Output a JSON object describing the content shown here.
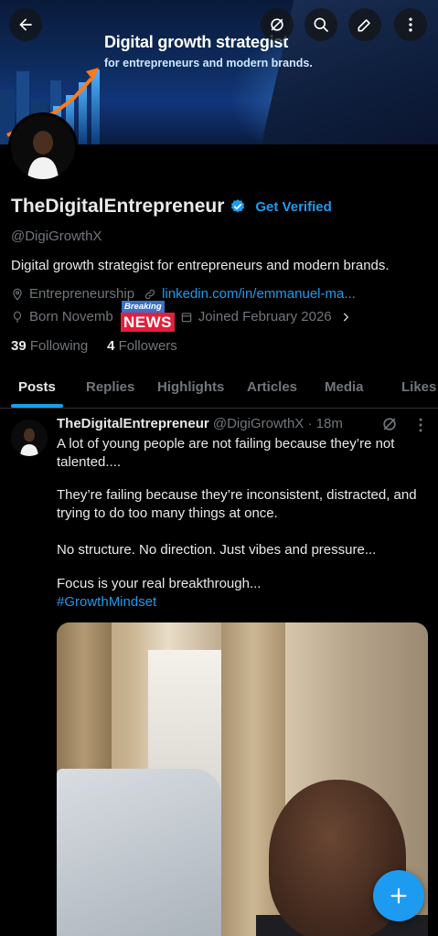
{
  "banner": {
    "headline": "Digital growth strategist",
    "subline": "for entrepreneurs and modern brands."
  },
  "top_actions": {
    "back_icon": "arrow-left-icon",
    "grok_icon": "grok-icon",
    "search_icon": "search-icon",
    "edit_icon": "edit-icon",
    "more_icon": "more-vertical-icon"
  },
  "profile": {
    "display_name": "TheDigitalEntrepreneur",
    "get_verified": "Get Verified",
    "handle": "@DigiGrowthX",
    "bio": "Digital growth strategist for entrepreneurs and modern brands.",
    "category": "Entrepreneurship",
    "link": "linkedin.com/in/emmanuel-ma...",
    "born": "Born Novemb",
    "joined": "Joined February 2026",
    "following_count": "39",
    "following_label": "Following",
    "followers_count": "4",
    "followers_label": "Followers"
  },
  "news_sticker": {
    "top": "Breaking",
    "main": "NEWS"
  },
  "tabs": [
    {
      "label": "Posts"
    },
    {
      "label": "Replies"
    },
    {
      "label": "Highlights"
    },
    {
      "label": "Articles"
    },
    {
      "label": "Media"
    },
    {
      "label": "Likes"
    }
  ],
  "post": {
    "author_name": "TheDigitalEntrepreneur",
    "author_handle": "@DigiGrowthX",
    "time": "· 18m",
    "line1": "A lot of young people are not failing because they’re not talented....",
    "line2": "They’re failing because they’re inconsistent, distracted, and trying to do too many things at once.",
    "line3": "No structure. No direction. Just vibes and pressure...",
    "line4": "Focus is your real breakthrough...",
    "hashtag": "#GrowthMindset"
  },
  "colors": {
    "accent": "#1d9bf0",
    "text_primary": "#e7e9ea",
    "text_secondary": "#71767b",
    "background": "#000000"
  }
}
